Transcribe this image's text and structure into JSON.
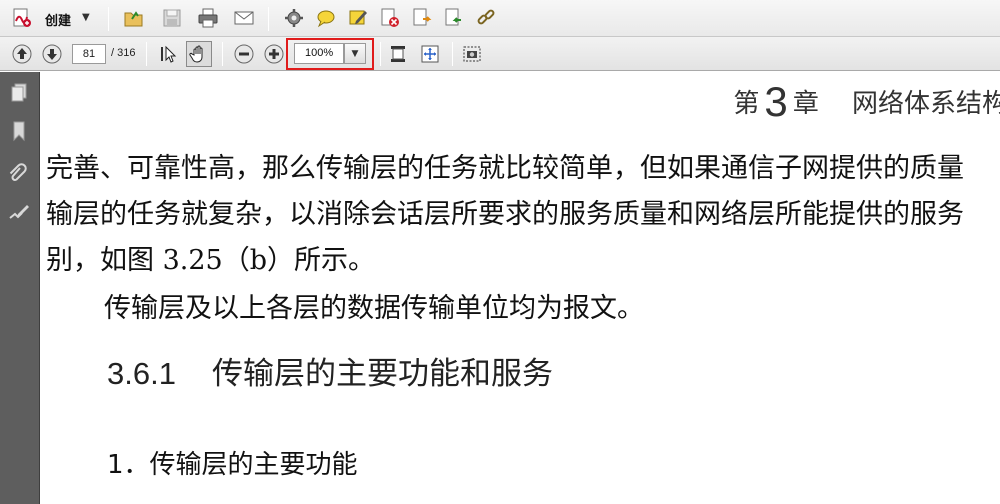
{
  "toolbar_main": {
    "create_label": "创建",
    "icons": [
      "create-pdf-icon",
      "open-folder-icon",
      "save-icon",
      "print-icon",
      "email-icon",
      "settings-icon",
      "comment-icon",
      "sticky-note-icon",
      "delete-icon",
      "export-icon",
      "import-icon",
      "link-icon"
    ]
  },
  "toolbar_nav": {
    "current_page": "81",
    "total_pages": "/ 316",
    "zoom_value": "100%"
  },
  "document": {
    "header_chapter_prefix": "第",
    "header_chapter_number": "3",
    "header_chapter_suffix": "章",
    "header_title": "网络体系结构",
    "lines": [
      "完善、可靠性高，那么传输层的任务就比较简单，但如果通信子网提供的质量",
      "输层的任务就复杂，以消除会话层所要求的服务质量和网络层所能提供的服务",
      "别，如图 3.25（b）所示。",
      "传输层及以上各层的数据传输单位均为报文。"
    ],
    "section_number": "3.6.1",
    "section_title": "传输层的主要功能和服务",
    "subsection": "1．传输层的主要功能"
  },
  "colors": {
    "highlight": "#e01b1b",
    "left_panel": "#5e5e5e"
  }
}
